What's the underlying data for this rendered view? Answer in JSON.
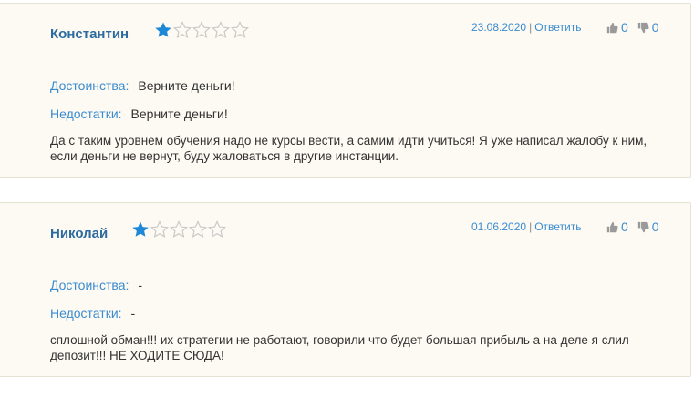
{
  "reviews": [
    {
      "author": "Константин",
      "rating": 1,
      "max_rating": 5,
      "date": "23.08.2020",
      "separator": "|",
      "reply_label": "Ответить",
      "likes": "0",
      "dislikes": "0",
      "pros_label": "Достоинства:",
      "pros": "Верните деньги!",
      "cons_label": "Недостатки:",
      "cons": "Верните деньги!",
      "text": "Да с таким уровнем обучения надо не курсы вести, а самим идти учиться! Я уже написал жалобу к ним, если деньги не вернут, буду жаловаться в другие инстанции."
    },
    {
      "author": "Николай",
      "rating": 1,
      "max_rating": 5,
      "date": "01.06.2020",
      "separator": "|",
      "reply_label": "Ответить",
      "likes": "0",
      "dislikes": "0",
      "pros_label": "Достоинства:",
      "pros": "-",
      "cons_label": "Недостатки:",
      "cons": "-",
      "text": "сплошной обман!!! их стратегии не работают, говорили что будет большая прибыль а на деле я слил депозит!!! НЕ ХОДИТЕ СЮДА!"
    }
  ],
  "colors": {
    "accent": "#3a8bd0",
    "author": "#2d6a9f",
    "star_filled": "#1e88d8",
    "star_empty": "#c9c9c9",
    "thumb": "#9a9a9a",
    "card_bg": "#fcfaf2"
  },
  "icons": [
    "star-filled-icon",
    "star-empty-icon",
    "thumbs-up-icon",
    "thumbs-down-icon"
  ]
}
